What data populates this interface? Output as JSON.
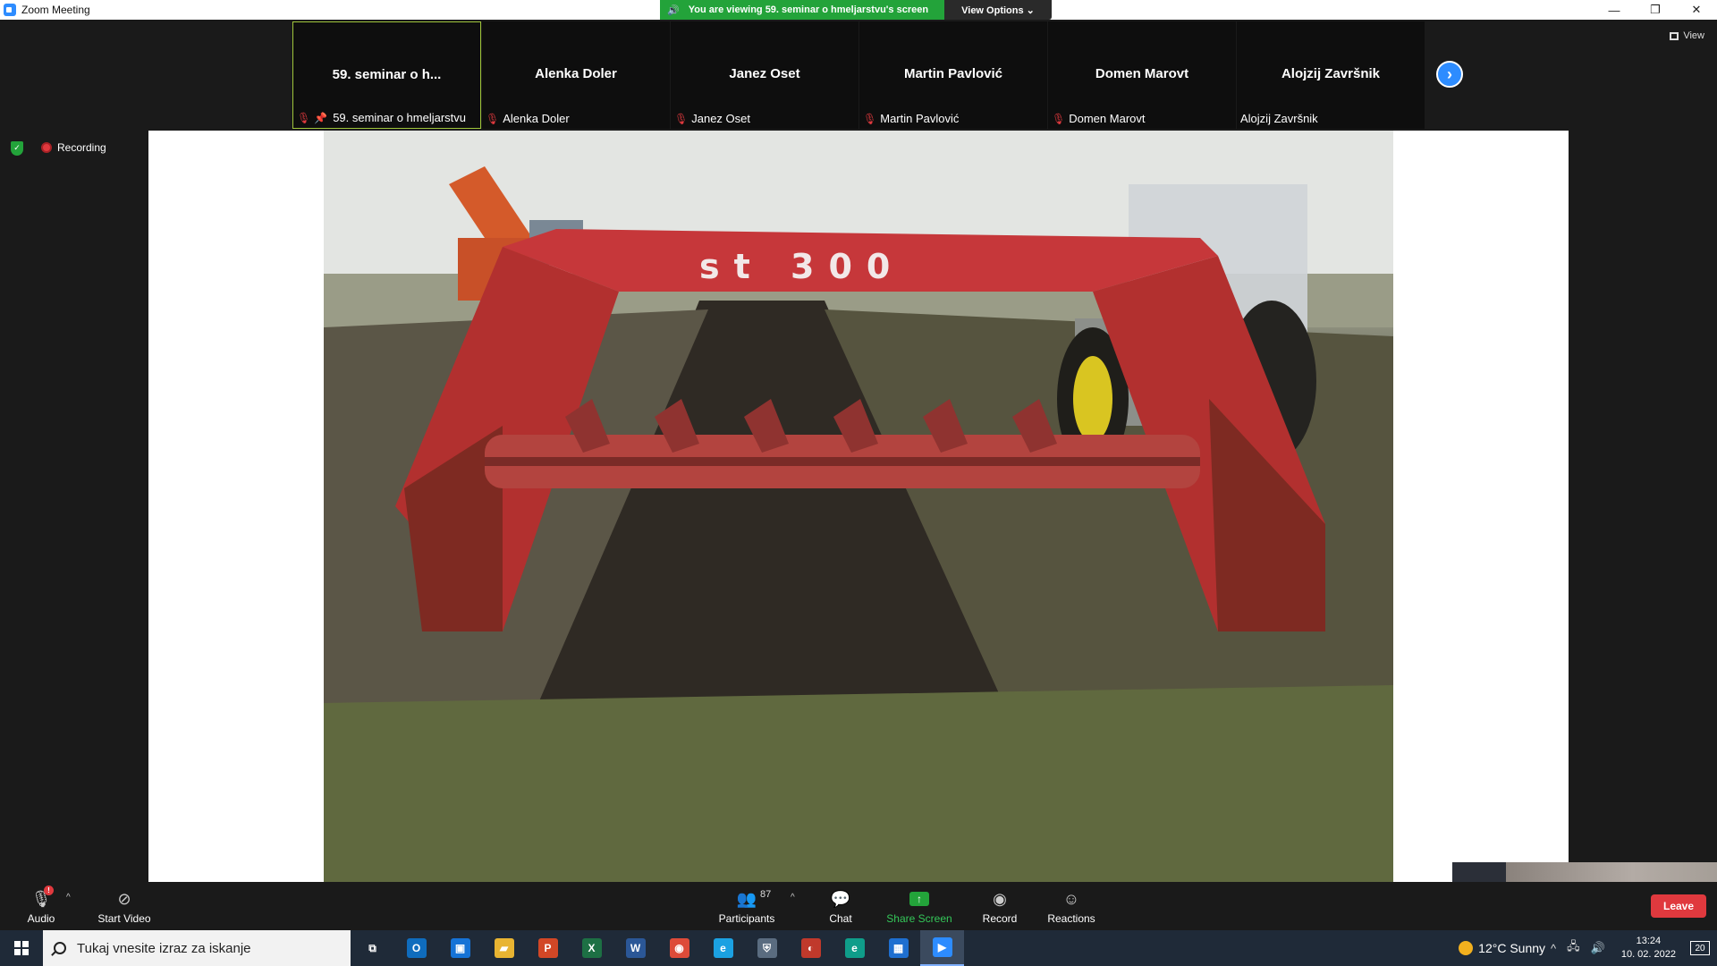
{
  "window": {
    "title": "Zoom Meeting",
    "controls": [
      "—",
      "❐",
      "✕"
    ]
  },
  "banner": {
    "message": "You are viewing 59. seminar o hmeljarstvu's screen",
    "view_options": "View Options ⌄"
  },
  "participants": [
    {
      "display": "59. seminar o h...",
      "label": "59. seminar o hmeljarstvu",
      "active": true,
      "pinned": true
    },
    {
      "display": "Alenka Doler",
      "label": "Alenka Doler"
    },
    {
      "display": "Janez Oset",
      "label": "Janez Oset"
    },
    {
      "display": "Martin Pavlović",
      "label": "Martin Pavlović"
    },
    {
      "display": "Domen Marovt",
      "label": "Domen Marovt"
    },
    {
      "display": "Alojzij Završnik",
      "label": "Alojzij Završnik"
    }
  ],
  "view_button": "View",
  "recording_label": "Recording",
  "shared_content": {
    "machine_text": "st 300"
  },
  "controls": {
    "audio": "Audio",
    "start_video": "Start Video",
    "participants": "Participants",
    "participants_count": "87",
    "chat": "Chat",
    "share_screen": "Share Screen",
    "record": "Record",
    "reactions": "Reactions",
    "leave": "Leave",
    "mic_badge": "!"
  },
  "taskbar": {
    "search_placeholder": "Tukaj vnesite izraz za iskanje",
    "weather": "12°C  Sunny",
    "time": "13:24",
    "date": "10. 02. 2022",
    "notifications": "20",
    "apps": [
      {
        "icon": "task-view-icon",
        "glyph": "⧉",
        "color": "#1f2a38"
      },
      {
        "icon": "outlook-icon",
        "glyph": "O",
        "color": "#0f6cbd"
      },
      {
        "icon": "app-blue-icon",
        "glyph": "▣",
        "color": "#1673d6"
      },
      {
        "icon": "file-explorer-icon",
        "glyph": "▰",
        "color": "#e8b432"
      },
      {
        "icon": "powerpoint-icon",
        "glyph": "P",
        "color": "#d24726"
      },
      {
        "icon": "excel-icon",
        "glyph": "X",
        "color": "#1d7044"
      },
      {
        "icon": "word-icon",
        "glyph": "W",
        "color": "#2b5797"
      },
      {
        "icon": "chrome-icon",
        "glyph": "◉",
        "color": "#dd4b39"
      },
      {
        "icon": "internet-explorer-icon",
        "glyph": "e",
        "color": "#1ba1e2"
      },
      {
        "icon": "security-shield-icon",
        "glyph": "⛨",
        "color": "#5a6c80"
      },
      {
        "icon": "remote-app-icon",
        "glyph": "◐",
        "color": "#c0392b"
      },
      {
        "icon": "edge-icon",
        "glyph": "e",
        "color": "#0f9d8a"
      },
      {
        "icon": "photos-icon",
        "glyph": "▦",
        "color": "#1e6fd0"
      },
      {
        "icon": "zoom-icon",
        "glyph": "▶",
        "color": "#2d8cff"
      }
    ]
  }
}
